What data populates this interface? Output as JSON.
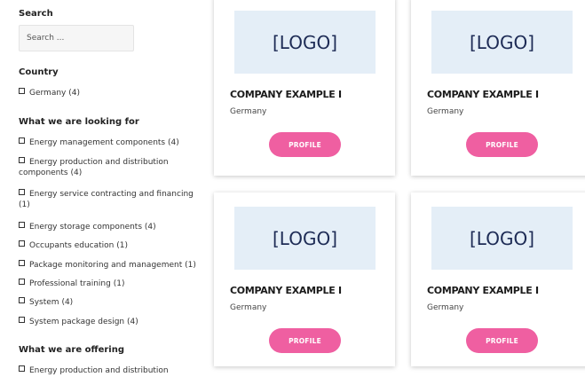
{
  "sidebar": {
    "search": {
      "title": "Search",
      "placeholder": "Search ..."
    },
    "country": {
      "title": "Country",
      "items": [
        {
          "label": "Germany",
          "count": "(4)"
        }
      ]
    },
    "looking_for": {
      "title": "What we are looking for",
      "items": [
        {
          "label": "Energy management components",
          "count": "(4)"
        },
        {
          "label": "Energy production and distribution components",
          "count": "(4)"
        },
        {
          "label": "Energy service contracting and financing",
          "count": "(1)"
        },
        {
          "label": "Energy storage components",
          "count": "(4)"
        },
        {
          "label": "Occupants education",
          "count": "(1)"
        },
        {
          "label": "Package monitoring and management",
          "count": "(1)"
        },
        {
          "label": "Professional training",
          "count": "(1)"
        },
        {
          "label": "System",
          "count": "(4)"
        },
        {
          "label": "System package design",
          "count": "(4)"
        }
      ]
    },
    "offering": {
      "title": "What we are offering",
      "items": [
        {
          "label": "Energy production and distribution",
          "count": ""
        }
      ]
    }
  },
  "cards": [
    {
      "logo": "[LOGO]",
      "name": "COMPANY EXAMPLE I",
      "country": "Germany",
      "button": "PROFILE"
    },
    {
      "logo": "[LOGO]",
      "name": "COMPANY EXAMPLE I",
      "country": "Germany",
      "button": "PROFILE"
    },
    {
      "logo": "[LOGO]",
      "name": "COMPANY EXAMPLE I",
      "country": "Germany",
      "button": "PROFILE"
    },
    {
      "logo": "[LOGO]",
      "name": "COMPANY EXAMPLE I",
      "country": "Germany",
      "button": "PROFILE"
    }
  ]
}
